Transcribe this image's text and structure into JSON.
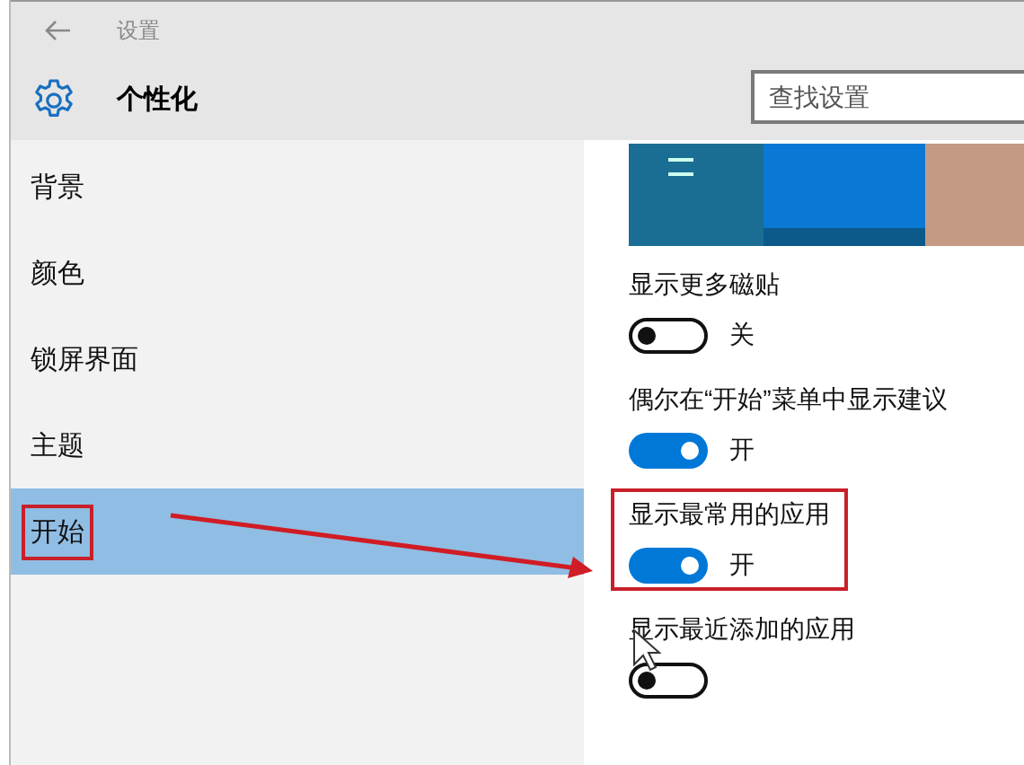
{
  "window": {
    "title": "设置"
  },
  "header": {
    "title": "个性化"
  },
  "search": {
    "placeholder": "查找设置"
  },
  "sidebar": {
    "items": [
      {
        "label": "背景",
        "selected": false,
        "annotated": false
      },
      {
        "label": "颜色",
        "selected": false,
        "annotated": false
      },
      {
        "label": "锁屏界面",
        "selected": false,
        "annotated": false
      },
      {
        "label": "主题",
        "selected": false,
        "annotated": false
      },
      {
        "label": "开始",
        "selected": true,
        "annotated": true
      }
    ]
  },
  "settings": [
    {
      "label": "显示更多磁贴",
      "on": false,
      "state_text": "关",
      "annotated": false
    },
    {
      "label": "偶尔在“开始”菜单中显示建议",
      "on": true,
      "state_text": "开",
      "annotated": false
    },
    {
      "label": "显示最常用的应用",
      "on": true,
      "state_text": "开",
      "annotated": true
    },
    {
      "label": "显示最近添加的应用",
      "on": false,
      "annotated": false
    }
  ]
}
